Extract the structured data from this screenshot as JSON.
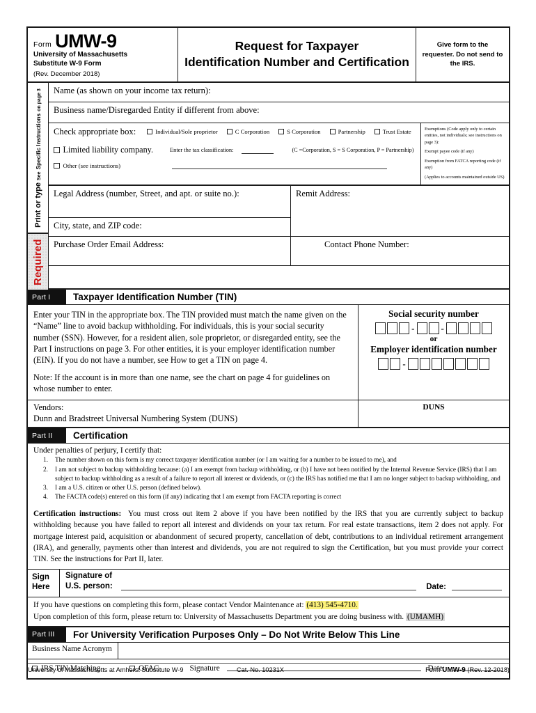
{
  "header": {
    "form_word": "Form",
    "form_number": "UMW-9",
    "sub_line1": "University of Massachusetts",
    "sub_line2": "Substitute W-9 Form",
    "revision": "(Rev. December 2018)",
    "title_line1": "Request for Taxpayer",
    "title_line2": "Identification Number and Certification",
    "right_note": "Give form to the requester.  Do not send to the IRS."
  },
  "rail": {
    "print_main": "Print or type",
    "print_see": "See",
    "print_specific": "Specific Instructions",
    "print_page": "on page 3",
    "required": "Required"
  },
  "fields": {
    "name_label": "Name (as shown on your income tax return):",
    "business_name_label": "Business name/Disregarded Entity if different from above:",
    "check_box_lead": "Check appropriate box:",
    "entity_options": [
      "Individual/Sole proprietor",
      "C Corporation",
      "S Corporation",
      "Partnership",
      "Trust  Estate"
    ],
    "llc_label": "Limited liability company.",
    "tax_class_label": "Enter the tax classification:",
    "tax_class_note": "(C =Corporation, S = S Corporation, P = Partnership)",
    "other_label": "Other (see instructions)",
    "legal_address_label": "Legal Address (number, Street, and apt. or suite no.):",
    "remit_address_label": "Remit Address:",
    "city_state_zip_label": "City, state, and ZIP code:",
    "po_email_label": "Purchase Order Email Address:",
    "contact_phone_label": "Contact Phone Number:"
  },
  "exemptions": {
    "line1": "Exemptions (Code apply only to certain entities, not individuals; see instructions on page 3):",
    "line2": "Exempt payee code (if any)",
    "line3": "Exemption from FATCA reporting code (if any)",
    "line4": "(Applies to accounts maintained outside US)"
  },
  "part1": {
    "tag": "Part I",
    "title": "Taxpayer Identification Number (TIN)",
    "paragraph": "Enter your TIN in the appropriate box.  The TIN provided must match the name given on the “Name” line to avoid backup withholding.  For individuals, this is your social security number (SSN).  However, for a resident alien, sole proprietor, or disregarded entity, see the Part I instructions on page 3.  For other entities, it is your employer identification number (EIN).  If you do not have a number, see How to get a TIN on page 4.",
    "note": "Note: If the account is in more than one name, see the chart on page 4 for guidelines on whose number to enter.",
    "ssn_label": "Social security number",
    "or_label": "or",
    "ein_label": "Employer identification number",
    "ssn_groups": [
      3,
      2,
      4
    ],
    "ein_groups": [
      2,
      7
    ]
  },
  "duns": {
    "vendors_label": "Vendors:",
    "duns_text": "Dunn and Bradstreet Universal Numbering System (DUNS)",
    "duns_header": "DUNS"
  },
  "part2": {
    "tag": "Part II",
    "title": "Certification",
    "lead": "Under penalties of perjury, I certify that:",
    "items": [
      "The number shown on this form is my correct taxpayer identification number (or I am waiting for a number to be issued to me), and",
      "I am not subject to backup withholding because: (a) I am exempt from backup withholding, or (b) I have not been notified by the Internal Revenue Service (IRS) that I am subject to backup withholding as a result of a failure to report all interest or dividends, or (c) the IRS has notified me that I am no longer subject to backup withholding, and",
      "I am a U.S. citizen or other U.S. person (defined below).",
      "The FACTA code(s) entered on this form (if any) indicating that I am exempt from FACTA reporting is correct"
    ],
    "instructions_label": "Certification instructions:",
    "instructions_text": "You must cross out item 2 above if you have been notified by the IRS that you are currently subject to backup withholding because you have failed to report all interest and dividends on your tax return.  For real estate transactions, item 2 does not apply.  For mortgage interest paid, acquisition or abandonment of secured property, cancellation of debt, contributions to an individual retirement arrangement (IRA), and generally, payments other than interest and dividends, you are not required to sign the Certification, but you must provide your correct TIN.  See the instructions for Part II, later."
  },
  "signature": {
    "sign_here_l1": "Sign",
    "sign_here_l2": "Here",
    "signature_l1": "Signature of",
    "signature_l2": "U.S. person:",
    "date_label": "Date:"
  },
  "contact": {
    "line1_pre": "If you have questions on completing this form, please contact Vendor Maintenance at: ",
    "phone": "(413) 545-4710.",
    "line2_pre": "Upon completion of this form, please return to: University of Massachusetts Department you are doing business with.  ",
    "acronym": "(UMAMH)"
  },
  "part3": {
    "tag": "Part III",
    "title": "For University Verification Purposes Only – Do Not Write Below This Line",
    "acronym_label": "Business Name Acronym",
    "irs_tin_label": "IRS TIN Matching",
    "ofac_label": "OFAC",
    "signature_label": "Signature",
    "date_label": "Date:"
  },
  "footer": {
    "left": "University of Massachusetts at Amherst Substitute W-9",
    "center": "Cat. No. 10231X",
    "right_pre": "Form ",
    "right_bold": "UMW-9",
    "right_post": " (Rev. 12-2018)"
  },
  "colors": {
    "required_red": "#cc1111",
    "highlight_yellow": "#fbf17a",
    "highlight_gray": "#d9d9d9",
    "part_bar": "#111111"
  }
}
